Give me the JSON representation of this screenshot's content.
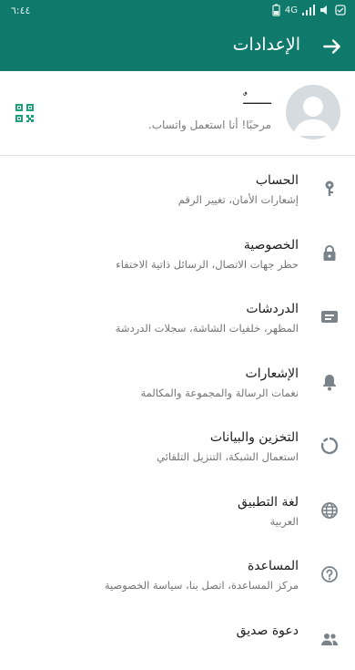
{
  "status_bar": {
    "time": "٦:٤٤",
    "network": "4G"
  },
  "app_bar": {
    "title": "الإعدادات"
  },
  "profile": {
    "name": "ـــــــٌ",
    "about": "مرحبًا! أنا استعمل واتساب."
  },
  "settings": [
    {
      "title": "الحساب",
      "subtitle": "إشعارات الأمان، تغيير الرقم",
      "icon": "key-icon"
    },
    {
      "title": "الخصوصية",
      "subtitle": "حظر جهات الاتصال، الرسائل ذاتية الاختفاء",
      "icon": "lock-icon"
    },
    {
      "title": "الدردشات",
      "subtitle": "المظهر، خلفيات الشاشة، سجلات الدردشة",
      "icon": "chat-icon"
    },
    {
      "title": "الإشعارات",
      "subtitle": "نغمات الرسالة والمجموعة والمكالمة",
      "icon": "bell-icon"
    },
    {
      "title": "التخزين والبيانات",
      "subtitle": "استعمال الشبكة، التنزيل التلقائي",
      "icon": "storage-icon"
    },
    {
      "title": "لغة التطبيق",
      "subtitle": "العربية",
      "icon": "globe-icon"
    },
    {
      "title": "المساعدة",
      "subtitle": "مركز المساعدة، اتصل بنا، سياسة الخصوصية",
      "icon": "help-icon"
    },
    {
      "title": "دعوة صديق",
      "subtitle": "",
      "icon": "people-icon"
    }
  ],
  "colors": {
    "primary": "#0f7a6c",
    "icon_gray": "#7a838a",
    "accent": "#1aa37a"
  }
}
